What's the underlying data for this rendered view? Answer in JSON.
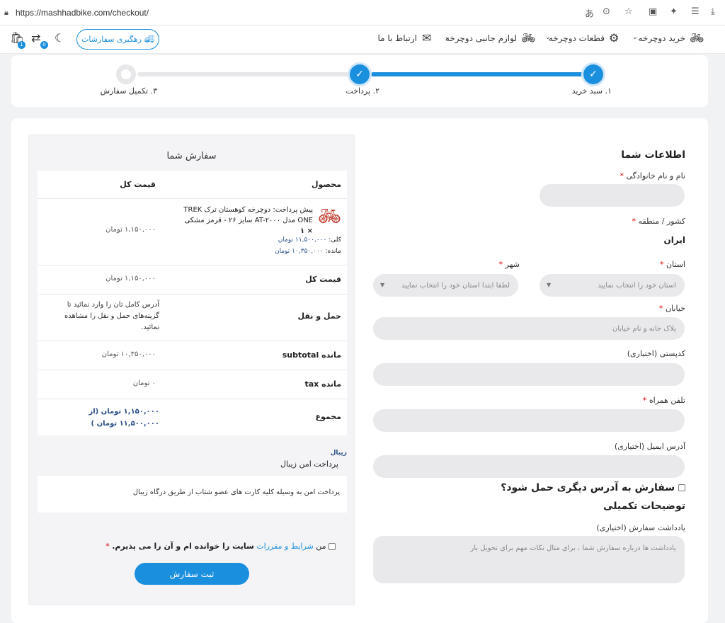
{
  "browser": {
    "url": "https://mashhadbike.com/checkout/"
  },
  "nav": {
    "buy_bike": "خرید دوچرخه",
    "parts": "قطعات دوچرخه",
    "accessories": "لوازم جانبی دوچرخه",
    "contact": "ارتباط با ما",
    "track_orders": "رهگیری سفارشات",
    "cart_count": "1",
    "compare_count": "0"
  },
  "steps": [
    {
      "label": "۱. سبد خرید",
      "state": "done"
    },
    {
      "label": "۲. پرداخت",
      "state": "done"
    },
    {
      "label": "۳. تکمیل سفارش",
      "state": "todo"
    }
  ],
  "form": {
    "title": "اطلاعات شما",
    "name_label": "نام و نام خانوادگی",
    "country_label": "کشور / منطقه",
    "country_value": "ایران",
    "state_label": "استان",
    "state_placeholder": "استان خود را انتخاب نمایید",
    "city_label": "شهر",
    "city_placeholder": "لطفا ابتدا استان خود را انتخاب نمایید",
    "street_label": "خیابان",
    "street_placeholder": "پلاک خانه و نام خیابان",
    "postcode_label": "کدپستی (اختیاری)",
    "phone_label": "تلفن همراه",
    "email_label": "آدرس ایمیل (اختیاری)",
    "ship_other": "سفارش به آدرس دیگری حمل شود؟",
    "extra_title": "توضیحات تکمیلی",
    "notes_label": "یادداشت سفارش (اختیاری)",
    "notes_placeholder": "یادداشت ها درباره سفارش شما ، برای مثال نکات مهم برای تحویل بار",
    "required_mark": "*"
  },
  "order": {
    "title": "سفارش شما",
    "col_product": "محصول",
    "col_total": "قیمت کل",
    "product_name": "پیش پرداخت: دوچرخه کوهستان ترک TREK ONE مدل AT-۲۰۰۰ سایز ۲۶ - قرمز مشکی",
    "product_qty": "× ۱",
    "product_price": "۱,۱۵۰,۰۰۰ تومان",
    "total_label": "کلی:",
    "total_value": "۱۱,۵۰۰,۰۰۰ تومان",
    "remain_label": "مانده:",
    "remain_value": "۱۰,۳۵۰,۰۰۰ تومان",
    "subtotal_label": "قیمت کل",
    "subtotal_value": "۱,۱۵۰,۰۰۰ تومان",
    "shipping_label": "حمل و نقل",
    "shipping_value": "آدرس کامل تان را وارد نمائید تا گزینه‌های حمل و نقل را مشاهده نمائید.",
    "remain_subtotal_label": "مانده subtotal",
    "remain_subtotal_value": "۱۰,۳۵۰,۰۰۰ تومان",
    "remain_tax_label": "مانده tax",
    "remain_tax_value": "۰ تومان",
    "grand_label": "مجموع",
    "grand_value": "۱,۱۵۰,۰۰۰ تومان (از ۱۱,۵۰۰,۰۰۰ تومان )",
    "payment_logo": "زیبال",
    "payment_name": "پرداخت امن زیبال",
    "payment_desc": "پرداخت امن به وسیله کلیه کارت های عضو شتاب از طریق درگاه زیبال",
    "terms_prefix": "من",
    "terms_link": "شرایط و مقررات",
    "terms_suffix": "سایت را خوانده ام و آن را می پذیرم.",
    "submit": "ثبت سفارش"
  },
  "colors": {
    "accent": "#1a8fdd",
    "required": "#dd0000"
  }
}
